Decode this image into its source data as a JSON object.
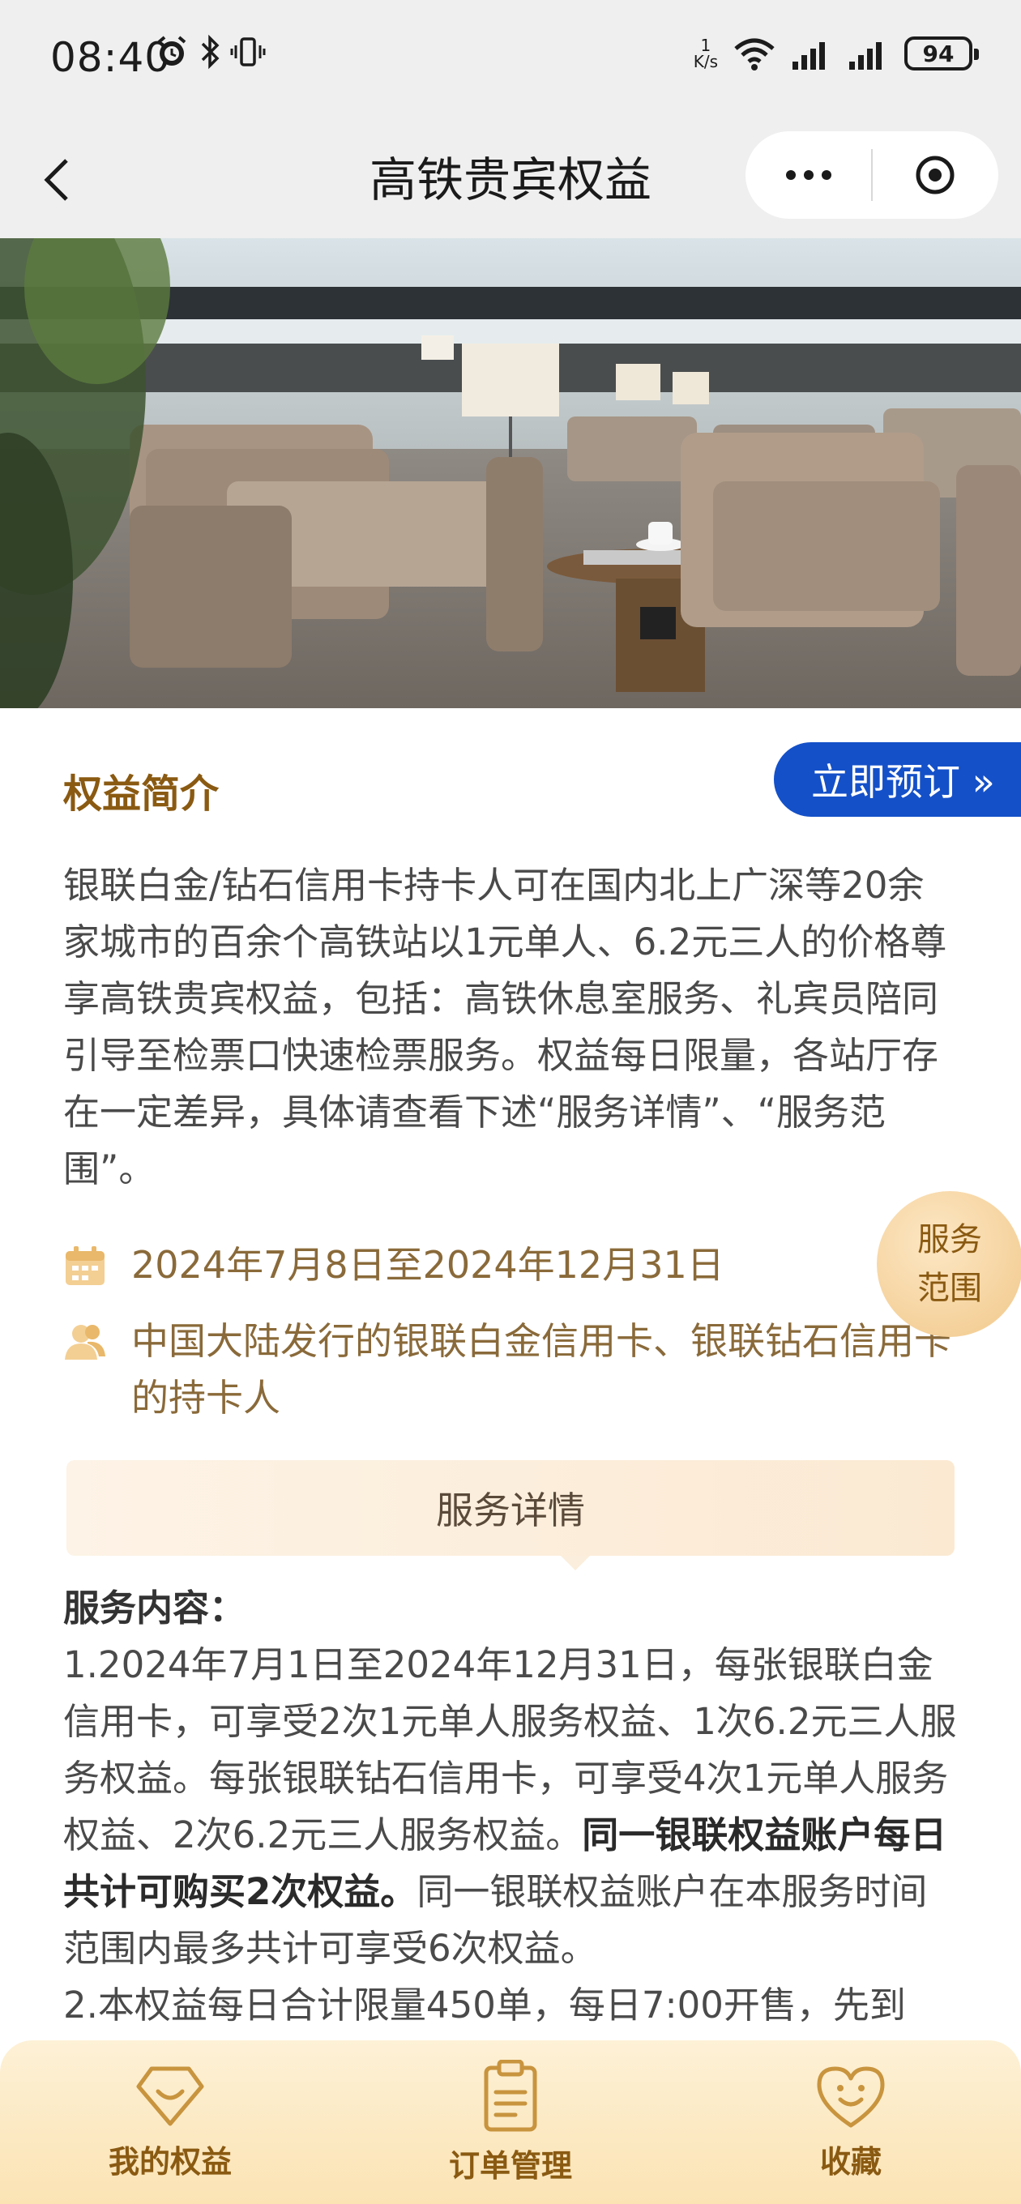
{
  "status_bar": {
    "time": "08:40",
    "speed_top": "1",
    "speed_unit": "K/s",
    "battery": "94"
  },
  "nav": {
    "title": "高铁贵宾权益"
  },
  "intro_section": {
    "title": "权益简介",
    "book_button": "立即预订 »",
    "description": "银联白金/钻石信用卡持卡人可在国内北上广深等20余家城市的百余个高铁站以1元单人、6.2元三人的价格尊享高铁贵宾权益，包括：高铁休息室服务、礼宾员陪同引导至检票口快速检票服务。权益每日限量，各站厅存在一定差异，具体请查看下述“服务详情”、“服务范围”。",
    "date_range": "2024年7月8日至2024年12月31日",
    "eligible": "中国大陆发行的银联白金信用卡、银联钻石信用卡的持卡人"
  },
  "scope_bubble": {
    "line1": "服务",
    "line2": "范围"
  },
  "details": {
    "header": "服务详情",
    "content_label": "服务内容：",
    "p1_a": "1.2024年7月1日至2024年12月31日，每张银联白金信用卡，可享受2次1元单人服务权益、1次6.2元三人服务权益。每张银联钻石信用卡，可享受4次1元单人服务权益、2次6.2元三人服务权益。",
    "p1_bold": "同一银联权益账户每日共计可购买2次权益。",
    "p1_b": "同一银联权益账户在本服务时间范围内最多共计可享受6次权益。",
    "p2": "2.本权益每日合计限量450单，每日7:00开售，先到"
  },
  "tabs": {
    "my_benefits": "我的权益",
    "orders": "订单管理",
    "favorites": "收藏"
  },
  "colors": {
    "accent_blue": "#1450c8",
    "gold_text": "#8a5a12",
    "tab_bg": "#fbe3b4"
  }
}
